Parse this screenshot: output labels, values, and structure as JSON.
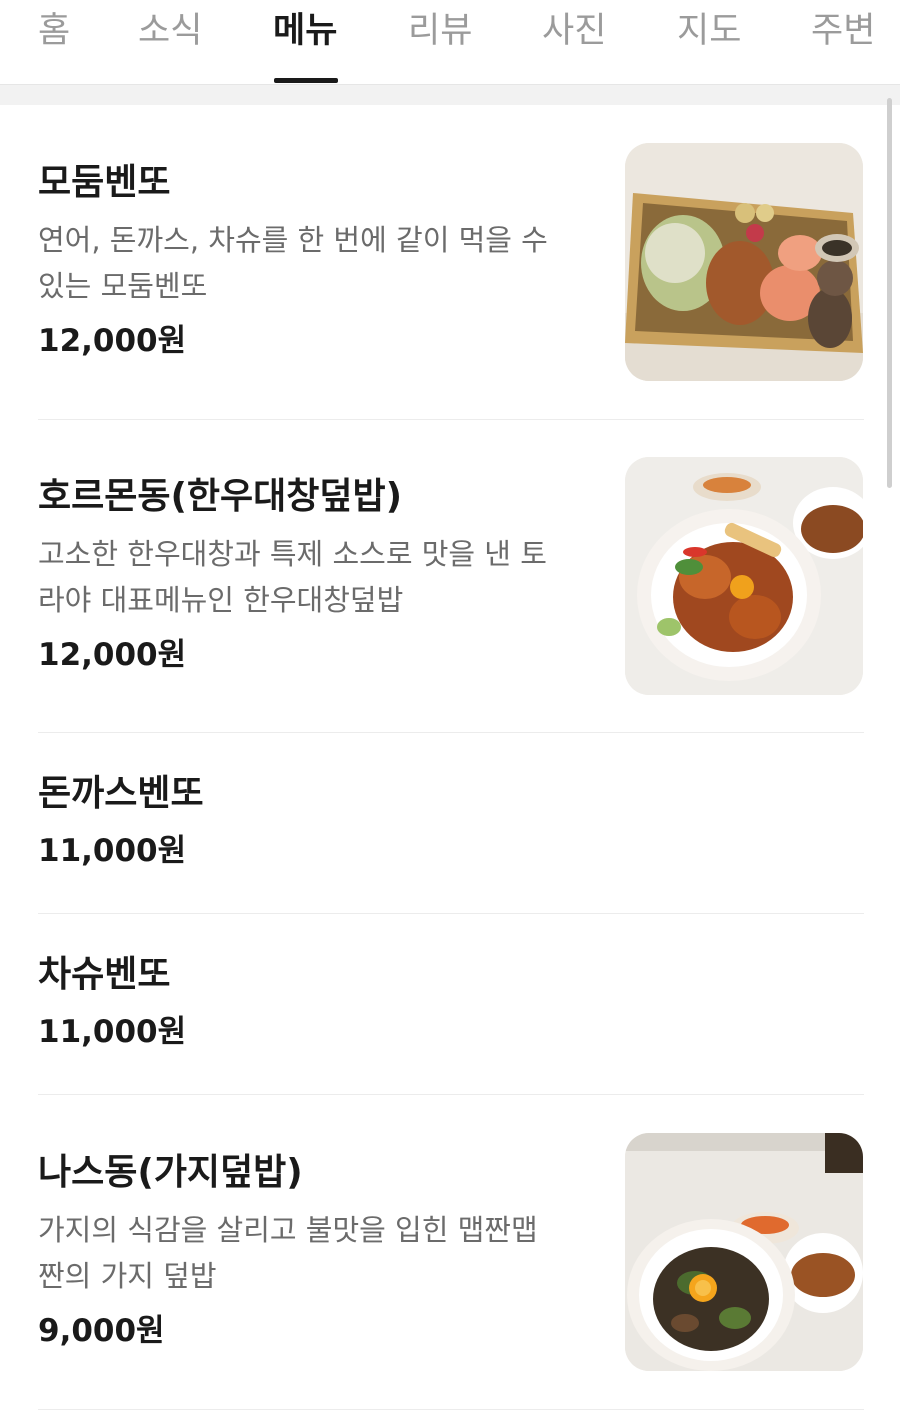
{
  "tabs": [
    {
      "label": "홈",
      "active": false
    },
    {
      "label": "소식",
      "active": false
    },
    {
      "label": "메뉴",
      "active": true
    },
    {
      "label": "리뷰",
      "active": false
    },
    {
      "label": "사진",
      "active": false
    },
    {
      "label": "지도",
      "active": false
    },
    {
      "label": "주변",
      "active": false
    }
  ],
  "menu": {
    "items": [
      {
        "name": "모둠벤또",
        "desc_line1": "연어, 돈까스, 차슈를 한 번에 같이 먹을 수",
        "desc_line2": "있는 모둠벤또",
        "price": "12,000원",
        "photo": "bento-box-photo"
      },
      {
        "name": "호르몬동(한우대창덮밥)",
        "desc_line1": "고소한 한우대창과 특제 소스로 맛을 낸 토",
        "desc_line2": "라야 대표메뉴인 한우대창덮밥",
        "price": "12,000원",
        "photo": "beef-intestine-rice-bowl-photo"
      },
      {
        "name": "돈까스벤또",
        "price": "11,000원"
      },
      {
        "name": "차슈벤또",
        "price": "11,000원"
      },
      {
        "name": "나스동(가지덮밥)",
        "desc_line1": "가지의 식감을 살리고 불맛을 입힌 맵짠맵",
        "desc_line2": "짠의 가지 덮밥",
        "price": "9,000원",
        "photo": "eggplant-rice-bowl-photo"
      }
    ]
  }
}
